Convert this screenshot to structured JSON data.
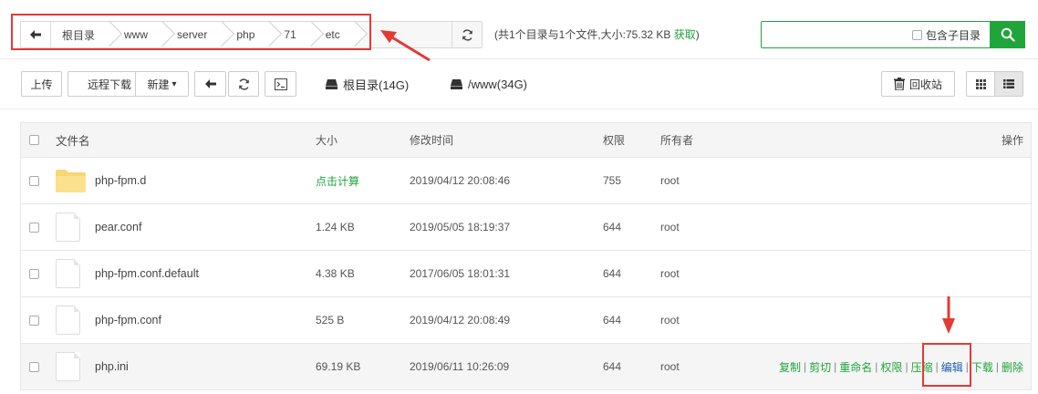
{
  "path": {
    "back_icon": "arrow-left-icon",
    "crumbs": [
      "根目录",
      "www",
      "server",
      "php",
      "71",
      "etc"
    ],
    "refresh_icon": "refresh-icon"
  },
  "summary": {
    "text": "(共1个目录与1个文件,大小:75.32 KB ",
    "fetch": "获取",
    "close": ")"
  },
  "search": {
    "value": "",
    "include_subdirs_label": "包含子目录",
    "include_subdirs_checked": false,
    "button_icon": "search-icon"
  },
  "toolbar": {
    "upload": "上传",
    "remote_download": "远程下载",
    "new": "新建",
    "new_caret": "▾",
    "back_icon": "arrow-left-icon",
    "refresh_icon": "refresh-icon",
    "terminal_icon": "terminal-icon",
    "disks": [
      {
        "label": "根目录(14G)",
        "icon": "hdd-icon"
      },
      {
        "label": "/www(34G)",
        "icon": "hdd-icon"
      }
    ],
    "recycle_bin": "回收站",
    "grid_view_icon": "grid-icon",
    "list_view_icon": "list-icon"
  },
  "table": {
    "headers": {
      "name": "文件名",
      "size": "大小",
      "mtime": "修改时间",
      "perm": "权限",
      "owner": "所有者",
      "ops": "操作"
    },
    "rows": [
      {
        "type": "folder",
        "name": "php-fpm.d",
        "size": "点击计算",
        "mtime": "2019/04/12 20:08:46",
        "perm": "755",
        "owner": "root"
      },
      {
        "type": "file",
        "name": "pear.conf",
        "size": "1.24 KB",
        "mtime": "2019/05/05 18:19:37",
        "perm": "644",
        "owner": "root"
      },
      {
        "type": "file",
        "name": "php-fpm.conf.default",
        "size": "4.38 KB",
        "mtime": "2017/06/05 18:01:31",
        "perm": "644",
        "owner": "root"
      },
      {
        "type": "file",
        "name": "php-fpm.conf",
        "size": "525 B",
        "mtime": "2019/04/12 20:08:49",
        "perm": "644",
        "owner": "root"
      },
      {
        "type": "file",
        "name": "php.ini",
        "size": "69.19 KB",
        "mtime": "2019/06/11 10:26:09",
        "perm": "644",
        "owner": "root"
      }
    ],
    "row_actions": [
      "复制",
      "剪切",
      "重命名",
      "权限",
      "压缩",
      "编辑",
      "下载",
      "删除"
    ]
  },
  "colors": {
    "accent": "#20a53a",
    "annotation": "#e53935",
    "folder": "#f8d775"
  }
}
